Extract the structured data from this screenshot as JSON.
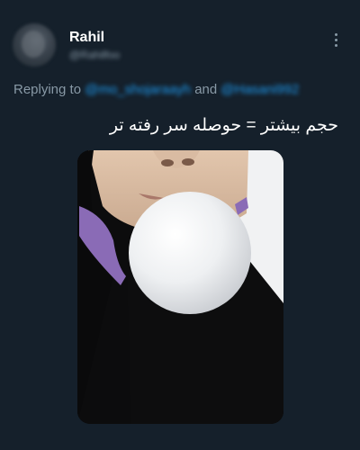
{
  "tweet": {
    "display_name": "Rahil",
    "handle": "@Rahilfoo",
    "reply": {
      "prefix": "Replying to",
      "mention_1": "@mo_shojaraayh",
      "conjunction": "and",
      "mention_2": "@Hasani992"
    },
    "text": "حجم بیشتر = حوصله سر رفته تر",
    "media_description": "photo"
  },
  "colors": {
    "background": "#15202b",
    "accent": "#1d9bf0",
    "muted": "#8899a6",
    "text": "#ffffff"
  },
  "icons": {
    "more": "more-vertical-icon"
  }
}
